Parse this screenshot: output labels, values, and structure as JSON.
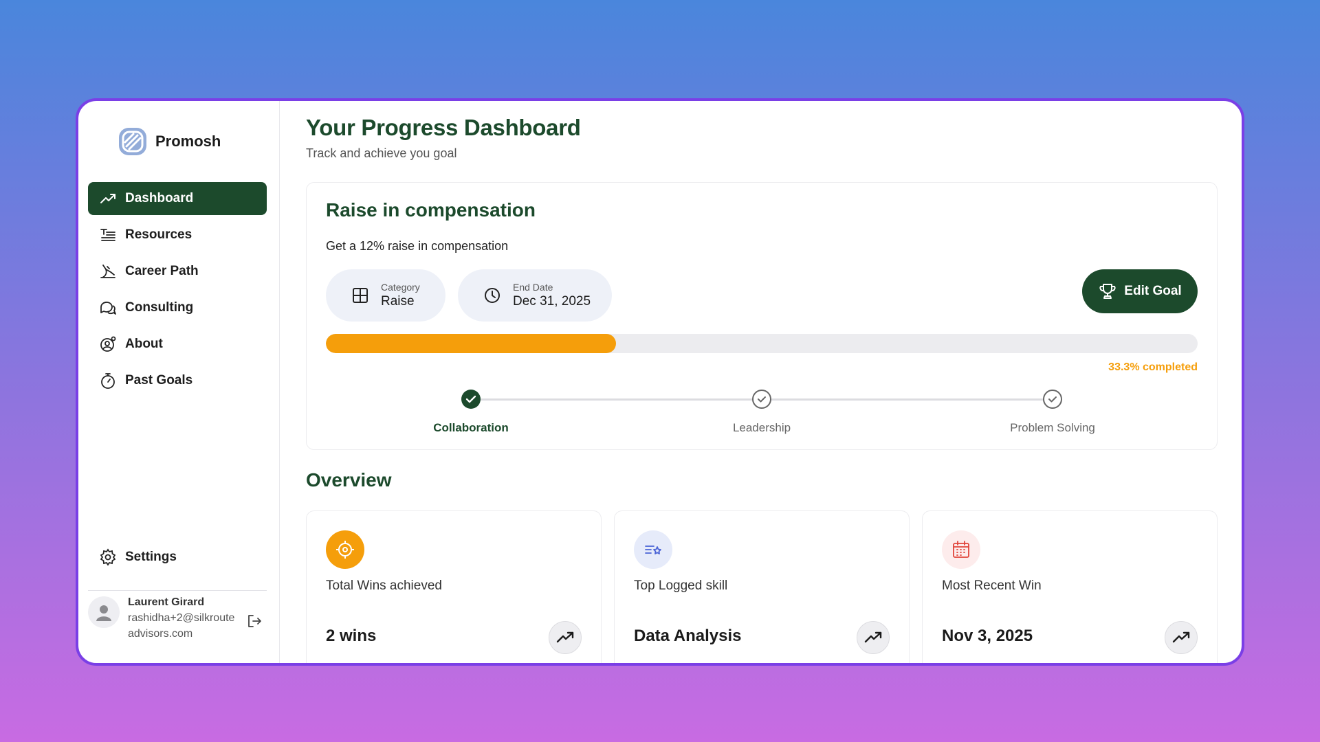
{
  "brand": {
    "name": "Promosh",
    "logo_icon": "promosh-logo-icon"
  },
  "sidebar": {
    "items": [
      {
        "label": "Dashboard",
        "icon": "trend-up-icon",
        "active": true
      },
      {
        "label": "Resources",
        "icon": "list-text-icon"
      },
      {
        "label": "Career Path",
        "icon": "stairs-icon"
      },
      {
        "label": "Consulting",
        "icon": "chat-bubbles-icon"
      },
      {
        "label": "About",
        "icon": "user-gear-icon"
      },
      {
        "label": "Past Goals",
        "icon": "stopwatch-icon"
      }
    ],
    "settings_label": "Settings",
    "user": {
      "name": "Laurent Girard",
      "email": "rashidha+2@silkrouteadvisors.com"
    }
  },
  "header": {
    "title": "Your Progress Dashboard",
    "subtitle": "Track and achieve you goal"
  },
  "goal": {
    "title": "Raise in compensation",
    "description": "Get a 12% raise in compensation",
    "category_label": "Category",
    "category_value": "Raise",
    "end_date_label": "End Date",
    "end_date_value": "Dec 31, 2025",
    "edit_label": "Edit Goal",
    "progress_fraction": 0.333,
    "progress_text": "33.3% completed",
    "steps": [
      {
        "label": "Collaboration",
        "done": true
      },
      {
        "label": "Leadership",
        "done": false
      },
      {
        "label": "Problem Solving",
        "done": false
      }
    ]
  },
  "overview": {
    "title": "Overview",
    "cards": [
      {
        "label": "Total Wins achieved",
        "value": "2 wins",
        "icon": "target-icon"
      },
      {
        "label": "Top Logged skill",
        "value": "Data Analysis",
        "icon": "skill-list-star-icon"
      },
      {
        "label": "Most Recent Win",
        "value": "Nov 3, 2025",
        "icon": "calendar-icon"
      }
    ]
  },
  "colors": {
    "brand_green": "#1c4a2c",
    "accent_orange": "#f59e0b",
    "window_border": "#7a3fe6"
  }
}
